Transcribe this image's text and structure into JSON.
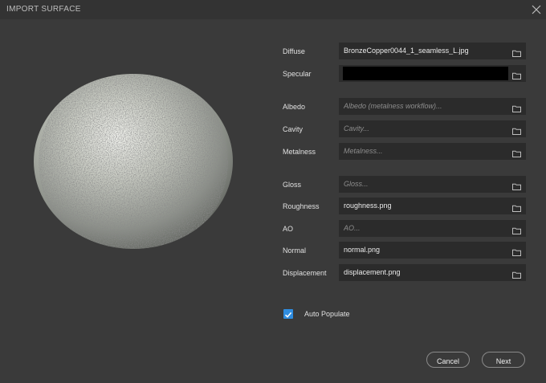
{
  "window": {
    "title": "IMPORT SURFACE"
  },
  "fields": [
    {
      "label": "Diffuse",
      "value": "BronzeCopper0044_1_seamless_L.jpg",
      "placeholder": ""
    },
    {
      "label": "Specular",
      "value": "",
      "placeholder": ""
    },
    {
      "label": "Albedo",
      "value": "",
      "placeholder": "Albedo (metalness workflow)..."
    },
    {
      "label": "Cavity",
      "value": "",
      "placeholder": "Cavity..."
    },
    {
      "label": "Metalness",
      "value": "",
      "placeholder": "Metalness..."
    },
    {
      "label": "Gloss",
      "value": "",
      "placeholder": "Gloss..."
    },
    {
      "label": "Roughness",
      "value": "roughness.png",
      "placeholder": ""
    },
    {
      "label": "AO",
      "value": "",
      "placeholder": "AO..."
    },
    {
      "label": "Normal",
      "value": "normal.png",
      "placeholder": ""
    },
    {
      "label": "Displacement",
      "value": "displacement.png",
      "placeholder": ""
    }
  ],
  "auto_populate": {
    "label": "Auto Populate",
    "checked": true
  },
  "buttons": {
    "cancel": "Cancel",
    "next": "Next"
  },
  "icons": {
    "close": "close-icon",
    "folder": "folder-icon",
    "check": "checkmark-icon"
  },
  "colors": {
    "background": "#3a3a3a",
    "field": "#2b2b2b",
    "accent": "#2f8de0"
  }
}
